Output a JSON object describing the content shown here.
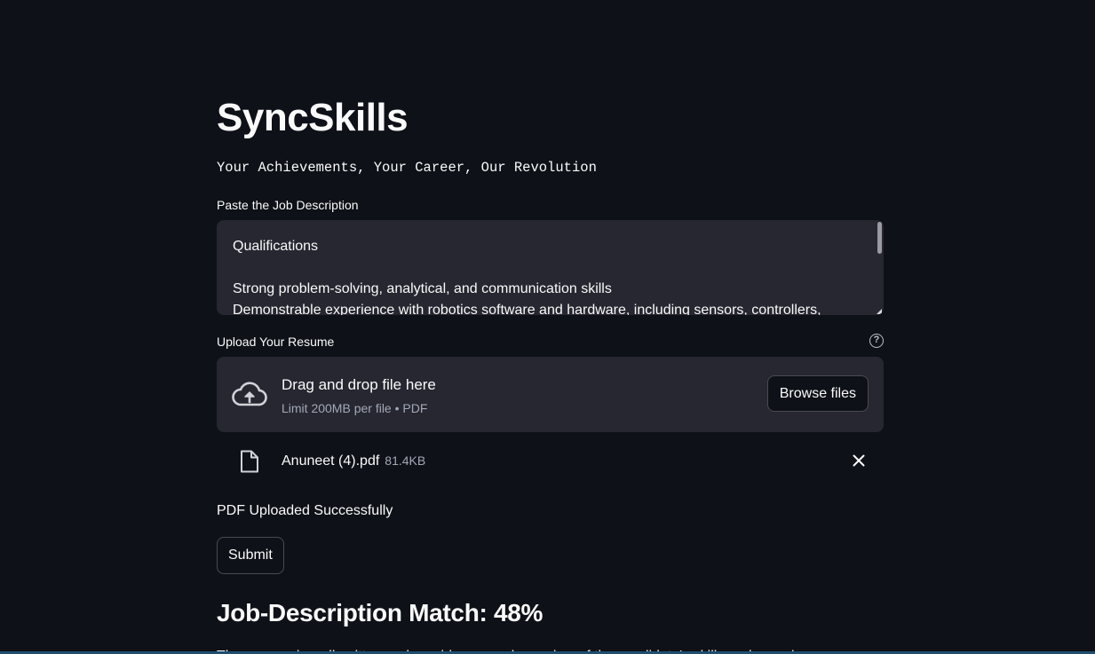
{
  "app": {
    "title": "SyncSkills",
    "subtitle": "Your Achievements, Your Career, Our Revolution"
  },
  "job_description": {
    "label": "Paste the Job Description",
    "lines": [
      "Qualifications",
      "",
      "Strong problem-solving, analytical, and communication skills",
      "Demonstrable experience with robotics software and hardware, including sensors, controllers,"
    ]
  },
  "upload": {
    "label": "Upload Your Resume",
    "help_icon": "question-circle-icon",
    "drop_text": "Drag and drop file here",
    "limit_text": "Limit 200MB per file • PDF",
    "browse_label": "Browse files",
    "cloud_icon": "cloud-upload-icon"
  },
  "uploaded_file": {
    "name": "Anuneet (4).pdf",
    "size": "81.4KB",
    "file_icon": "file-icon",
    "remove_icon": "close-icon"
  },
  "status": {
    "message": "PDF Uploaded Successfully"
  },
  "submit": {
    "label": "Submit"
  },
  "result": {
    "heading": "Job-Description Match: 48%",
    "match_percent": 48,
    "partial_text": "The resume is well-written and provides a good overview of the candidate's skills and experience"
  },
  "colors": {
    "background": "#0e1117",
    "input_bg": "#262730",
    "text": "#fafafa",
    "muted_text": "#a3a8b8"
  }
}
